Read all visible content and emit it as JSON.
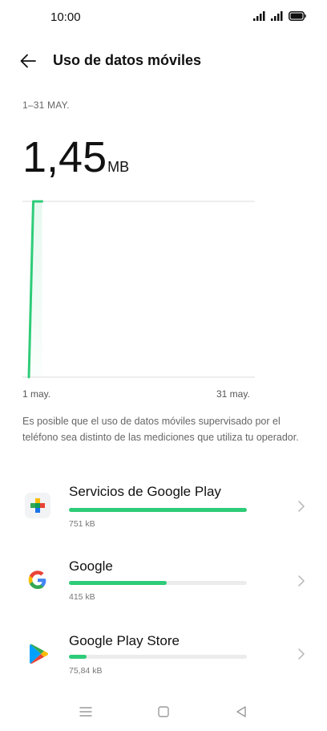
{
  "status_bar": {
    "time": "10:00"
  },
  "header": {
    "title": "Uso de datos móviles"
  },
  "summary": {
    "period": "1–31 MAY.",
    "total_value": "1,45",
    "total_unit": "MB"
  },
  "chart_data": {
    "type": "line",
    "x_start_label": "1 may.",
    "x_end_label": "31 may.",
    "x": [
      "1 may.",
      "2 may.",
      "31 may."
    ],
    "y": [
      0,
      1.45,
      null
    ],
    "ylim": [
      0,
      1.45
    ],
    "series_color": "#2ecc78"
  },
  "disclaimer": "Es posible que el uso de datos móviles supervisado por el teléfono sea distinto de las mediciones que utiliza tu operador.",
  "apps": [
    {
      "name": "Servicios de Google Play",
      "size": "751 kB",
      "share": 1.0,
      "icon": "google-play-services-icon"
    },
    {
      "name": "Google",
      "size": "415 kB",
      "share": 0.55,
      "icon": "google-icon"
    },
    {
      "name": "Google Play Store",
      "size": "75,84 kB",
      "share": 0.1,
      "icon": "google-play-store-icon"
    }
  ],
  "colors": {
    "accent": "#2ecc78",
    "track": "#ececec"
  }
}
